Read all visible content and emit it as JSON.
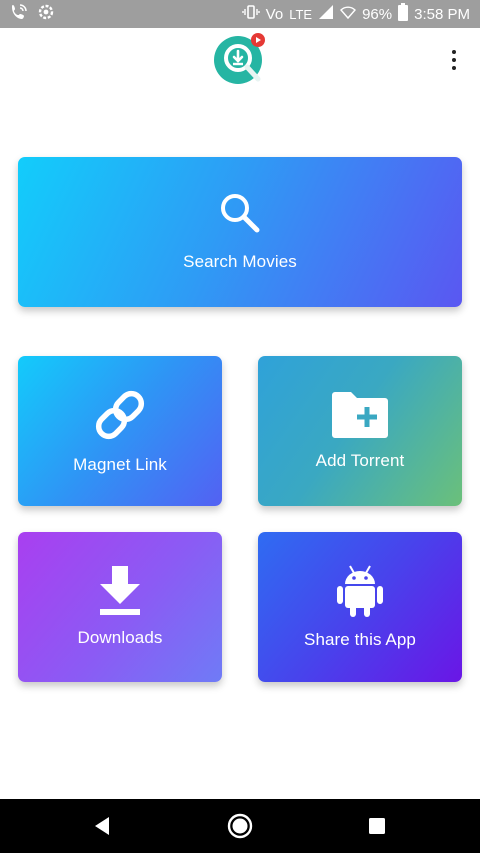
{
  "status_bar": {
    "battery": "96%",
    "time": "3:58 PM",
    "network": "Vo",
    "network_sub": "LTE",
    "icons": [
      "phone-wifi-icon",
      "settings-icon",
      "vibrate-icon",
      "signal-icon",
      "wifi-icon",
      "battery-icon"
    ]
  },
  "app_bar": {
    "logo_icon": "search-download-logo-icon",
    "menu_icon": "more-vert-icon"
  },
  "cards": {
    "search": {
      "label": "Search Movies",
      "icon": "search-icon"
    },
    "magnet": {
      "label": "Magnet Link",
      "icon": "link-icon"
    },
    "torrent": {
      "label": "Add Torrent",
      "icon": "folder-add-icon"
    },
    "downloads": {
      "label": "Downloads",
      "icon": "download-icon"
    },
    "share": {
      "label": "Share this App",
      "icon": "android-icon"
    }
  },
  "nav_bar": {
    "back_icon": "back-icon",
    "home_icon": "home-icon",
    "recents_icon": "recents-icon"
  },
  "colors": {
    "logo_teal": "#26b5a3",
    "logo_badge": "#e53935",
    "status_bar": "#9e9e9e"
  }
}
